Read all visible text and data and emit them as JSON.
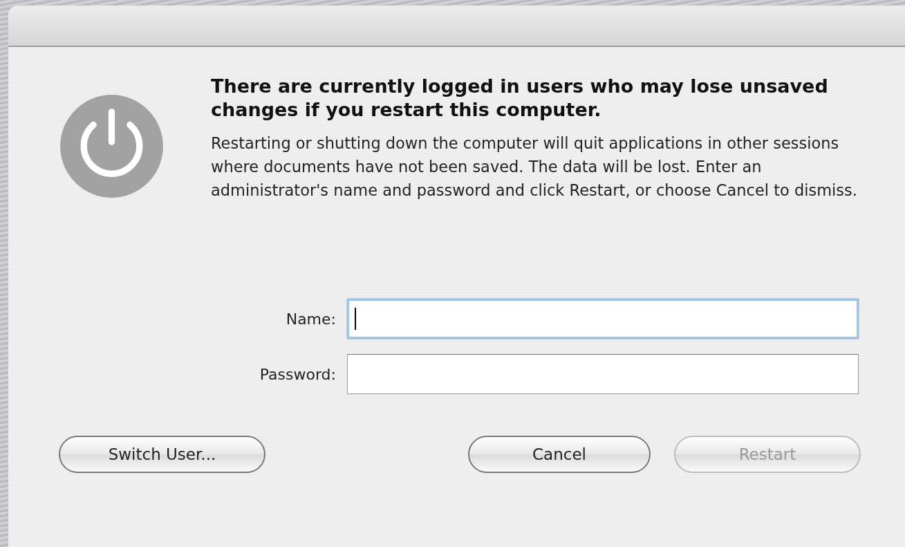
{
  "dialog": {
    "heading": "There are currently logged in users who may lose unsaved changes if you restart this computer.",
    "message": "Restarting or shutting down the computer will quit applications in other sessions where documents have not been saved.  The data will be lost.  Enter an administrator's name and password and click Restart, or choose Cancel to dismiss."
  },
  "fields": [
    {
      "label": "Name:",
      "focused": true
    },
    {
      "label": "Password:",
      "focused": false
    }
  ],
  "left_buttons": [
    {
      "label": "Switch User...",
      "disabled": false
    }
  ],
  "right_buttons": [
    {
      "label": "Cancel",
      "disabled": false
    },
    {
      "label": "Restart",
      "disabled": true
    }
  ]
}
